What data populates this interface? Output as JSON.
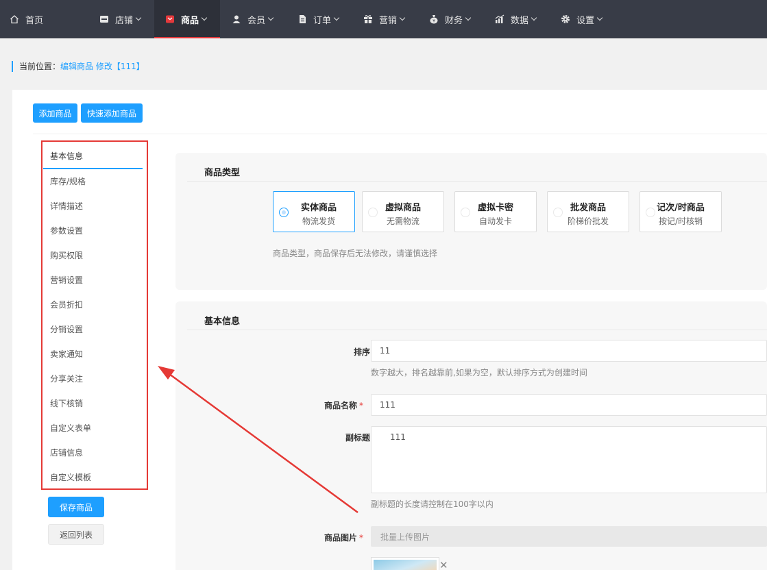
{
  "topnav": {
    "items": [
      {
        "label": "首页",
        "icon": "home-icon"
      },
      {
        "label": "店铺",
        "icon": "store-icon"
      },
      {
        "label": "商品",
        "icon": "product-icon",
        "active": true
      },
      {
        "label": "会员",
        "icon": "user-icon"
      },
      {
        "label": "订单",
        "icon": "document-icon"
      },
      {
        "label": "营销",
        "icon": "gift-icon"
      },
      {
        "label": "财务",
        "icon": "money-bag-icon"
      },
      {
        "label": "数据",
        "icon": "chart-icon"
      },
      {
        "label": "设置",
        "icon": "gear-icon"
      }
    ],
    "active_color": "#e4393c",
    "bg_color": "#383c47"
  },
  "breadcrumb": {
    "label": "当前位置：",
    "path": "编辑商品 修改【111】"
  },
  "toolbar": {
    "add_product": "添加商品",
    "quick_add_product": "快速添加商品"
  },
  "side_tabs": [
    "基本信息",
    "库存/规格",
    "详情描述",
    "参数设置",
    "购买权限",
    "营销设置",
    "会员折扣",
    "分销设置",
    "卖家通知",
    "分享关注",
    "线下核销",
    "自定义表单",
    "店铺信息",
    "自定义模板"
  ],
  "actions": {
    "save": "保存商品",
    "back": "返回列表"
  },
  "product_type": {
    "title": "商品类型",
    "options": [
      {
        "name": "实体商品",
        "desc": "物流发货",
        "selected": true
      },
      {
        "name": "虚拟商品",
        "desc": "无需物流"
      },
      {
        "name": "虚拟卡密",
        "desc": "自动发卡"
      },
      {
        "name": "批发商品",
        "desc": "阶梯价批发"
      },
      {
        "name": "记次/时商品",
        "desc": "按记/时核销"
      }
    ],
    "hint": "商品类型，商品保存后无法修改，请谨慎选择"
  },
  "basic_info": {
    "title": "基本信息",
    "sort_label": "排序",
    "sort_value": "11",
    "sort_hint": "数字越大，排名越靠前,如果为空，默认排序方式为创建时间",
    "name_label": "商品名称",
    "name_value": "111",
    "subtitle_label": "副标题",
    "subtitle_value": "111",
    "subtitle_hint": "副标题的长度请控制在100字以内",
    "image_label": "商品图片",
    "upload_button": "批量上传图片",
    "required_mark": "*"
  },
  "colors": {
    "primary": "#1e9fff",
    "annotation_red": "#e53935"
  }
}
